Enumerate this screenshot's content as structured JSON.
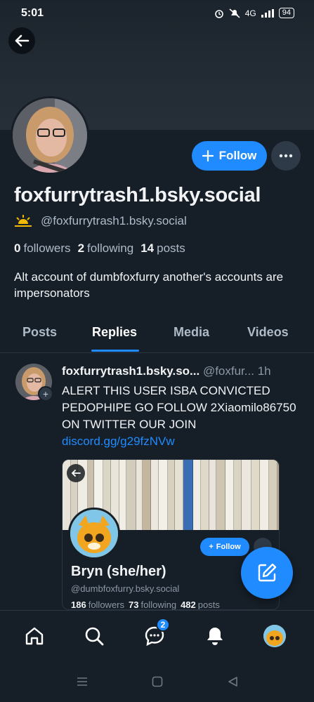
{
  "status_bar": {
    "time": "5:01",
    "network": "4G",
    "battery": "94"
  },
  "profile": {
    "display_name": "foxfurrytrash1.bsky.social",
    "handle": "@foxfurrytrash1.bsky.social",
    "follow_label": "Follow",
    "followers_count": "0",
    "followers_label": "followers",
    "following_count": "2",
    "following_label": "following",
    "posts_count": "14",
    "posts_label": "posts",
    "bio": "Alt account of dumbfoxfurry another's accounts are impersonators"
  },
  "tabs": [
    {
      "label": "Posts",
      "active": false
    },
    {
      "label": "Replies",
      "active": true
    },
    {
      "label": "Media",
      "active": false
    },
    {
      "label": "Videos",
      "active": false
    }
  ],
  "post": {
    "author_name": "foxfurrytrash1.bsky.so...",
    "author_handle": "@foxfur...",
    "time": "1h",
    "text": "ALERT THIS USER ISBA CONVICTED PEDOPHIPE GO FOLLOW 2Xiaomilo86750 ON TWITTER OUR JOIN",
    "link": "discord.gg/g29fzNVw",
    "embed": {
      "name": "Bryn (she/her)",
      "handle": "@dumbfoxfurry.bsky.social",
      "follow_label": "Follow",
      "followers_count": "186",
      "followers_label": "followers",
      "following_count": "73",
      "following_label": "following",
      "posts_count": "482",
      "posts_label": "posts"
    }
  },
  "bottom_nav": {
    "items": [
      "home-icon",
      "search-icon",
      "chat-icon",
      "bell-icon",
      "profile-avatar"
    ],
    "chat_badge": "2"
  },
  "colors": {
    "accent": "#208bfe",
    "background": "#161e27",
    "muted_text": "#aebbc9"
  }
}
